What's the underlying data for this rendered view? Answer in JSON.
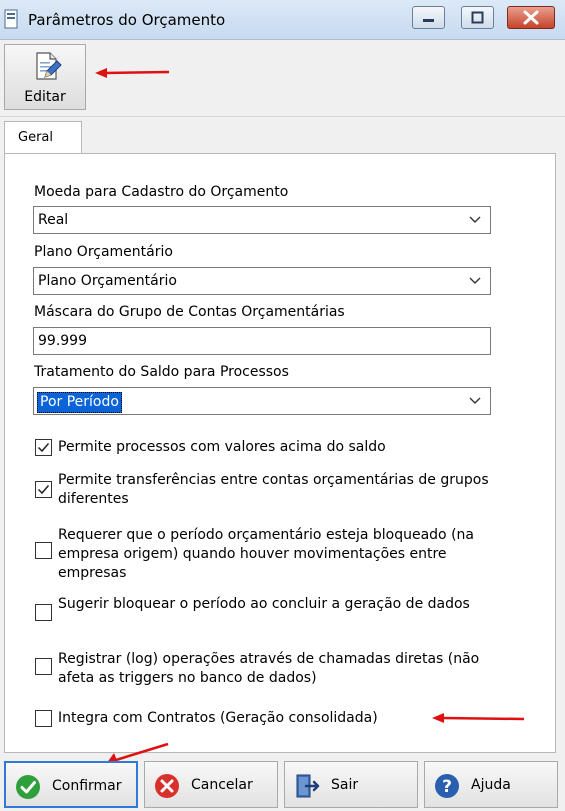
{
  "window": {
    "title": "Parâmetros do Orçamento"
  },
  "toolbar": {
    "edit_label": "Editar"
  },
  "tabs": [
    {
      "label": "Geral"
    }
  ],
  "form": {
    "currency": {
      "label": "Moeda para Cadastro do Orçamento",
      "value": "Real"
    },
    "budget_plan": {
      "label": "Plano Orçamentário",
      "value": "Plano Orçamentário"
    },
    "mask": {
      "label": "Máscara do Grupo de Contas Orçamentárias",
      "value": "99.999"
    },
    "balance_treatment": {
      "label": "Tratamento do Saldo para Processos",
      "value": "Por Período"
    }
  },
  "checkboxes": [
    {
      "label": "Permite processos com valores acima do saldo",
      "checked": true
    },
    {
      "label": "Permite transferências entre contas orçamentárias de grupos diferentes",
      "checked": true
    },
    {
      "label": "Requerer que o período orçamentário esteja bloqueado (na empresa origem) quando houver movimentações entre empresas",
      "checked": false
    },
    {
      "label": "Sugerir bloquear o período ao concluir a geração de dados",
      "checked": false
    },
    {
      "label": "Registrar (log) operações através de chamadas diretas (não afeta as triggers no banco de dados)",
      "checked": false
    },
    {
      "label": "Integra com Contratos (Geração consolidada)",
      "checked": false
    }
  ],
  "buttons": {
    "confirm": "Confirmar",
    "cancel": "Cancelar",
    "exit": "Sair",
    "help": "Ajuda"
  },
  "colors": {
    "annotation_arrow": "#e01010",
    "selection": "#0a64d7",
    "confirm_icon": "#2e9f3a",
    "cancel_icon": "#d8302a",
    "help_icon": "#2a5fb0"
  }
}
